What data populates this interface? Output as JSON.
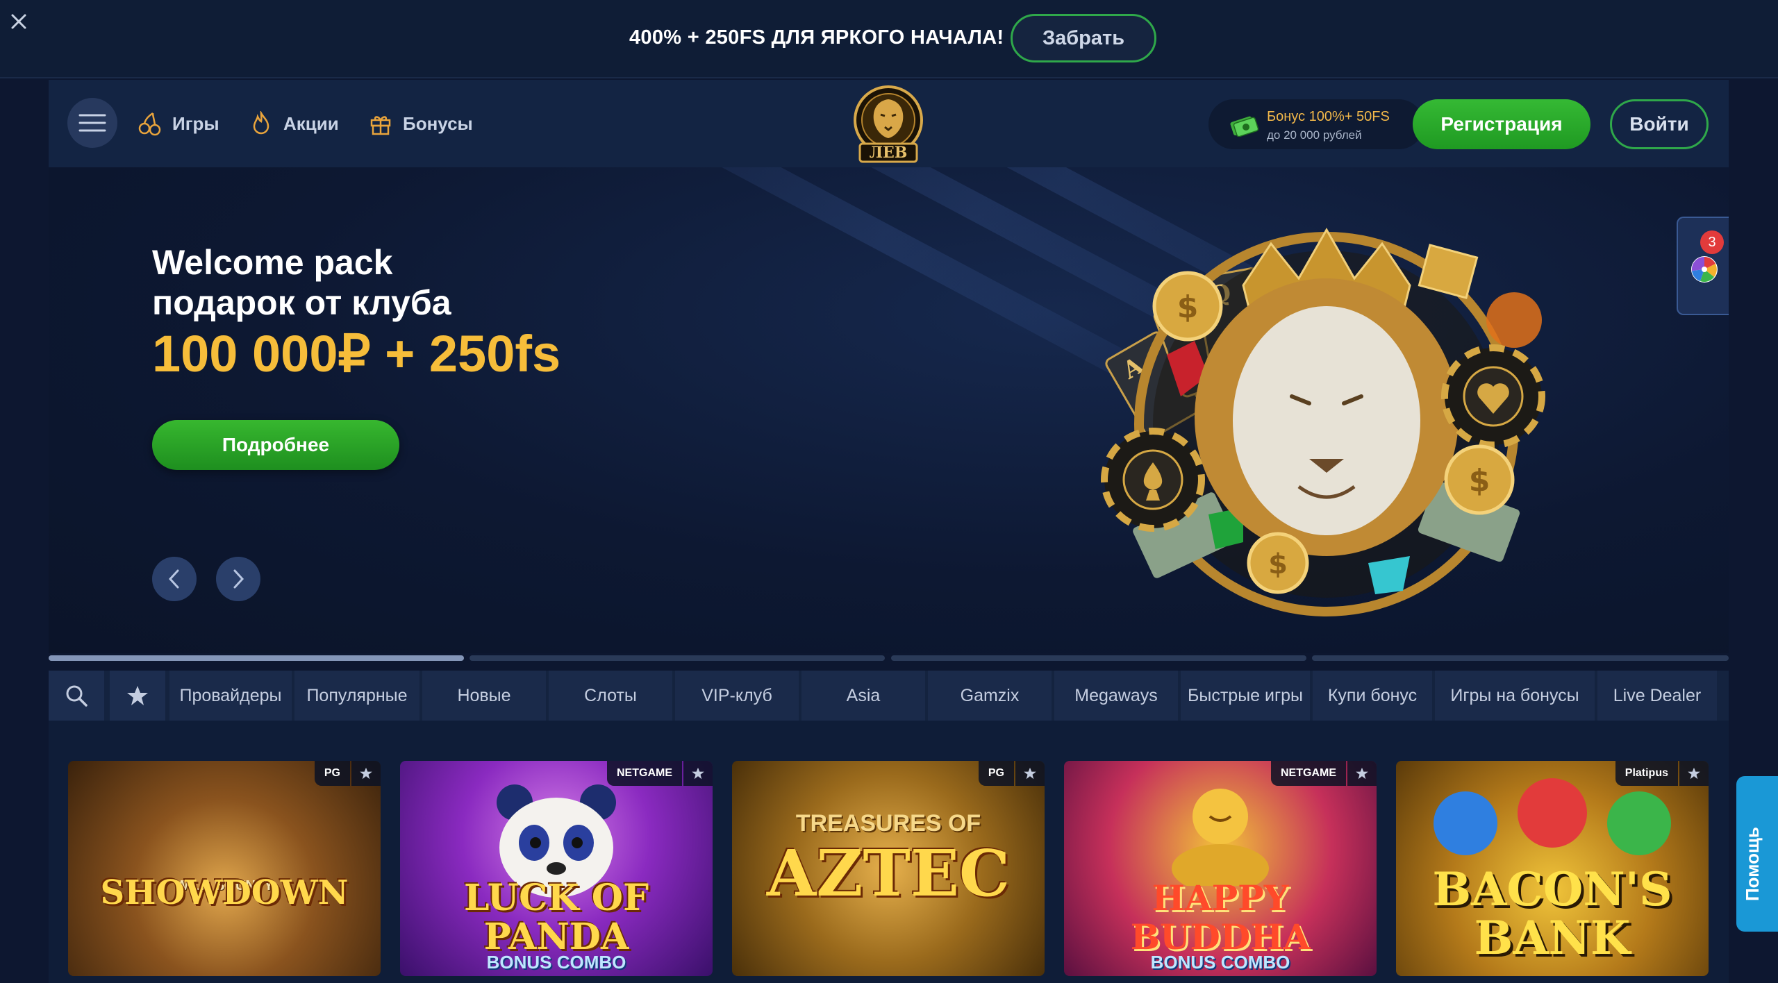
{
  "promo": {
    "text": "400% + 250FS ДЛЯ ЯРКОГО НАЧАЛА!",
    "button": "Забрать",
    "close_icon": "close-icon"
  },
  "header": {
    "nav": [
      {
        "label": "Игры",
        "icon": "cherries-icon"
      },
      {
        "label": "Акции",
        "icon": "flame-icon"
      },
      {
        "label": "Бонусы",
        "icon": "gift-icon"
      }
    ],
    "logo_text": "ЛЕВ",
    "bonus": {
      "line1": "Бонус 100%+ 50FS",
      "line2": "до 20 000 рублей"
    },
    "register": "Регистрация",
    "login": "Войти"
  },
  "hero": {
    "title1": "Welcome pack",
    "title2": "подарок от клуба",
    "amount": "100 000₽ + 250fs",
    "button": "Подробнее",
    "slides_total": 4,
    "slide_active": 1
  },
  "wheel": {
    "badge": "3"
  },
  "categories": {
    "tabs": [
      "Провайдеры",
      "Популярные",
      "Новые",
      "Слоты",
      "VIP-клуб",
      "Asia",
      "Gamzix",
      "Megaways",
      "Быстрые игры",
      "Купи бонус",
      "Игры на бонусы",
      "Live Dealer"
    ]
  },
  "games": [
    {
      "title": "SHOWDOWN",
      "sub": "WILD BOUNTY",
      "provider": "PG"
    },
    {
      "title": "LUCK OF PANDA",
      "sub": "BONUS COMBO",
      "provider": "NETGAME"
    },
    {
      "title": "AZTEC",
      "sub": "TREASURES OF",
      "provider": "PG"
    },
    {
      "title": "HAPPY BUDDHA",
      "sub": "BONUS COMBO",
      "provider": "NETGAME"
    },
    {
      "title": "BACON'S BANK",
      "sub": "",
      "provider": "Platipus"
    }
  ],
  "help": {
    "label": "Помощь"
  },
  "colors": {
    "accent_green": "#2fa84a",
    "gold": "#f6bd3a",
    "bg": "#0d1730"
  }
}
